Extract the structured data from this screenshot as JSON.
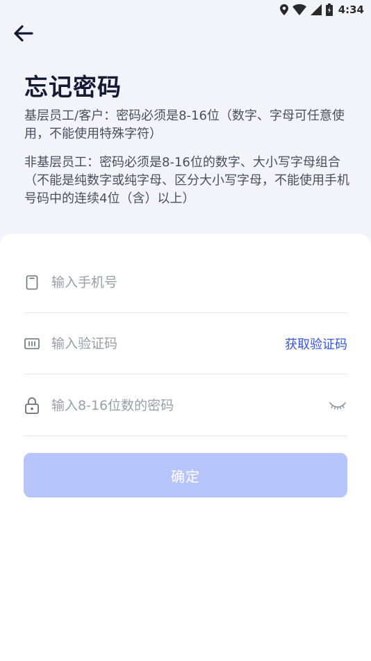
{
  "status_bar": {
    "time": "4:34"
  },
  "header": {
    "title": "忘记密码",
    "rule_basic": "基层员工/客户：密码必须是8-16位（数字、字母可任意使用，不能使用特殊字符）",
    "rule_non_basic": "非基层员工：密码必须是8-16位的数字、大小写字母组合（不能是纯数字或纯字母、区分大小写字母，不能使用手机号码中的连续4位（含）以上）"
  },
  "form": {
    "phone_placeholder": "输入手机号",
    "code_placeholder": "输入验证码",
    "get_code_label": "获取验证码",
    "password_placeholder": "输入8-16位数的密码",
    "confirm_label": "确定"
  },
  "colors": {
    "accent": "#3757e0",
    "button_disabled": "#b8c5fc",
    "background": "#f3f4fa"
  }
}
